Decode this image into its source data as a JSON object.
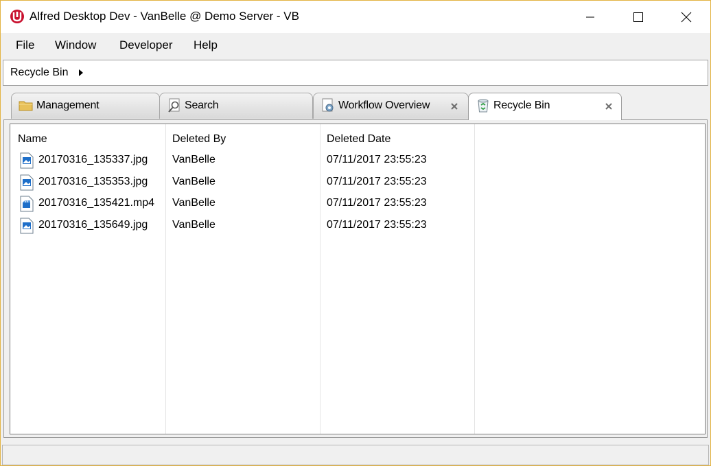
{
  "window": {
    "title": "Alfred Desktop Dev - VanBelle @ Demo Server - VB",
    "controls": [
      "minimize-icon",
      "maximize-icon",
      "close-icon"
    ]
  },
  "menu": {
    "items": [
      {
        "label": "File"
      },
      {
        "label": "Window"
      },
      {
        "label": "Developer"
      },
      {
        "label": "Help"
      }
    ]
  },
  "breadcrumb": {
    "label": "Recycle Bin"
  },
  "tabs": [
    {
      "label": "Management",
      "icon": "folder-icon",
      "closable": false,
      "active": false
    },
    {
      "label": "Search",
      "icon": "search-icon",
      "closable": false,
      "active": false
    },
    {
      "label": "Workflow Overview",
      "icon": "workflow-icon",
      "closable": true,
      "active": false
    },
    {
      "label": "Recycle Bin",
      "icon": "recycle-bin-icon",
      "closable": true,
      "active": true
    }
  ],
  "table": {
    "columns": [
      "Name",
      "Deleted By",
      "Deleted Date"
    ],
    "rows": [
      {
        "name": "20170316_135337.jpg",
        "type": "image",
        "deleted_by": "VanBelle",
        "deleted_date": "07/11/2017 23:55:23"
      },
      {
        "name": "20170316_135353.jpg",
        "type": "image",
        "deleted_by": "VanBelle",
        "deleted_date": "07/11/2017 23:55:23"
      },
      {
        "name": "20170316_135421.mp4",
        "type": "video",
        "deleted_by": "VanBelle",
        "deleted_date": "07/11/2017 23:55:23"
      },
      {
        "name": "20170316_135649.jpg",
        "type": "image",
        "deleted_by": "VanBelle",
        "deleted_date": "07/11/2017 23:55:23"
      }
    ]
  },
  "colors": {
    "accent_icon": "#c8102e",
    "file_icon_blue": "#1e6fc9",
    "window_border": "#e3b341"
  }
}
